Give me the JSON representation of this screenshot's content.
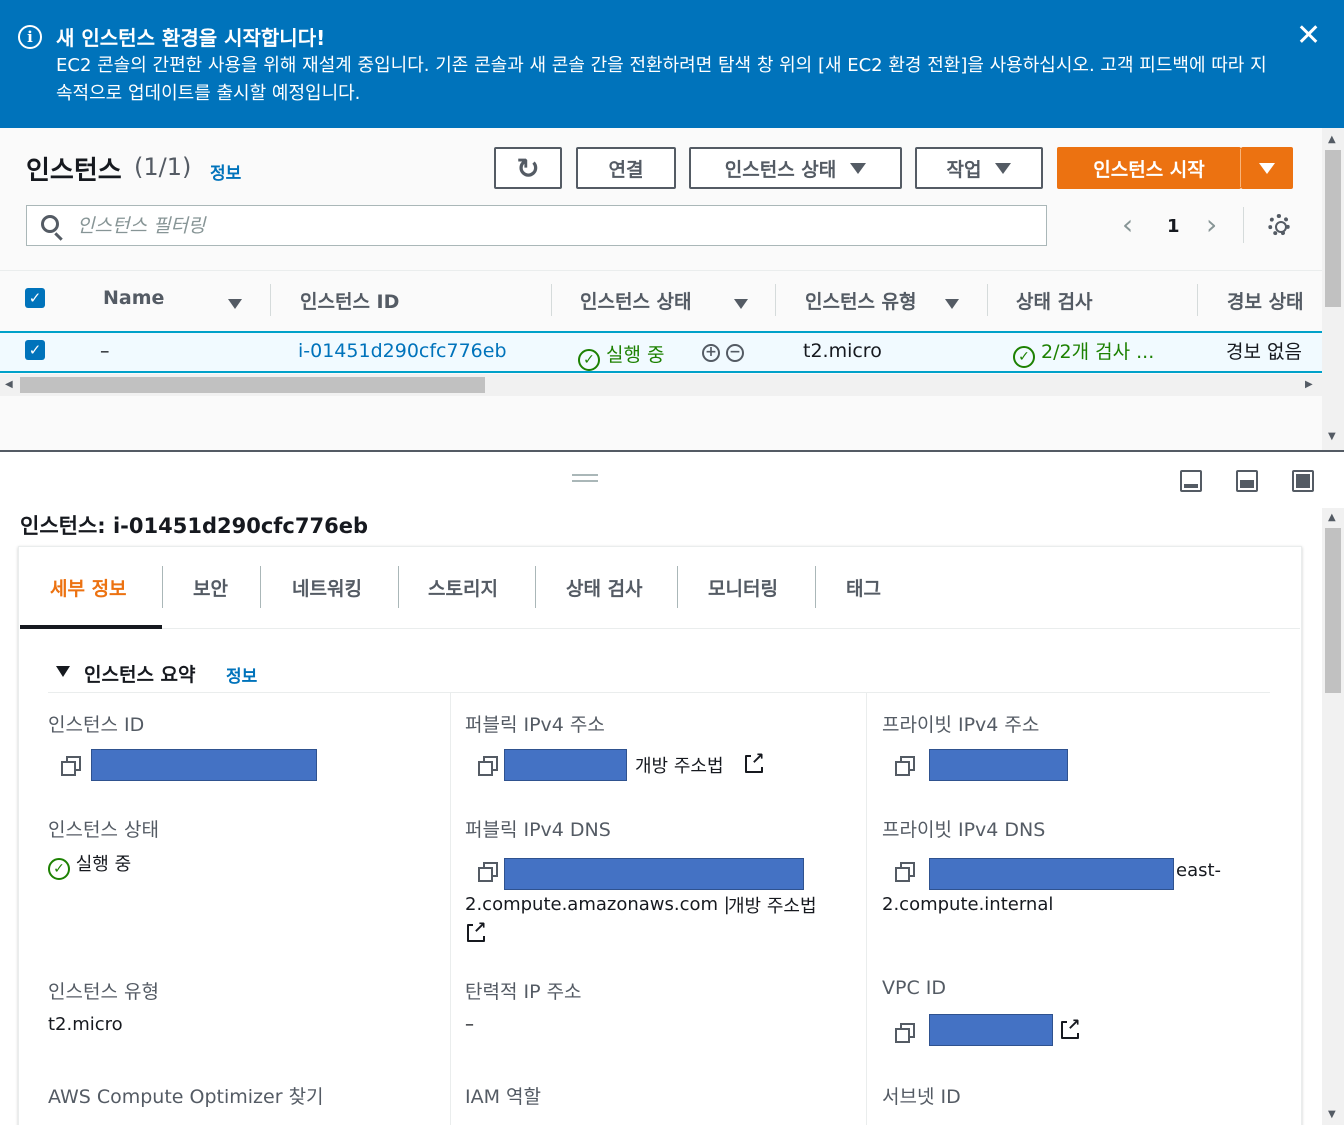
{
  "banner": {
    "title": "새 인스턴스 환경을 시작합니다!",
    "message": "EC2 콘솔의 간편한 사용을 위해 재설계 중입니다. 기존 콘솔과 새 콘솔 간을 전환하려면 탐색 창 위의 [새 EC2 환경 전환]을 사용하십시오. 고객 피드백에 따라 지속적으로 업데이트를 출시할 예정입니다.",
    "close_glyph": "✕",
    "info_glyph": "i"
  },
  "header": {
    "title": "인스턴스",
    "count": "(1/1)",
    "info_link": "정보"
  },
  "toolbar": {
    "connect": "연결",
    "instance_state": "인스턴스 상태",
    "actions": "작업",
    "launch": "인스턴스 시작",
    "refresh_glyph": "↻"
  },
  "search": {
    "placeholder": "인스턴스 필터링"
  },
  "pagination": {
    "page": "1",
    "prev_glyph": "‹",
    "next_glyph": "›"
  },
  "table": {
    "columns": [
      "Name",
      "인스턴스 ID",
      "인스턴스 상태",
      "인스턴스 유형",
      "상태 검사",
      "경보 상태"
    ],
    "row": {
      "name": "–",
      "id": "i-01451d290cfc776eb",
      "state": "실행 중",
      "type": "t2.micro",
      "status_check": "2/2개 검사 ...",
      "alarm": "경보 없음"
    }
  },
  "details": {
    "title": "인스턴스: i-01451d290cfc776eb",
    "tabs": [
      "세부 정보",
      "보안",
      "네트워킹",
      "스토리지",
      "상태 검사",
      "모니터링",
      "태그"
    ],
    "section_title": "인스턴스 요약",
    "section_info": "정보",
    "fields": {
      "instance_id_label": "인스턴스 ID",
      "public_ipv4_label": "퍼블릭 IPv4 주소",
      "private_ipv4_label": "프라이빗 IPv4 주소",
      "open_address": "개방 주소법",
      "instance_state_label": "인스턴스 상태",
      "instance_state_value": "실행 중",
      "public_dns_label": "퍼블릭 IPv4 DNS",
      "public_dns_suffix": "2.compute.amazonaws.com |",
      "private_dns_label": "프라이빗 IPv4 DNS",
      "private_dns_partial": "east-",
      "private_dns_suffix": "2.compute.internal",
      "instance_type_label": "인스턴스 유형",
      "instance_type_value": "t2.micro",
      "elastic_ip_label": "탄력적 IP 주소",
      "elastic_ip_value": "–",
      "vpc_label": "VPC ID",
      "optimizer_label": "AWS Compute Optimizer 찾기",
      "iam_label": "IAM 역할",
      "subnet_label": "서브넷 ID"
    }
  },
  "icons": {
    "check": "✓",
    "zoom_in": "+",
    "zoom_out": "−"
  },
  "colors": {
    "banner_bg": "#0073bb",
    "primary": "#ec7211",
    "link": "#0073bb",
    "success": "#1d8102"
  }
}
